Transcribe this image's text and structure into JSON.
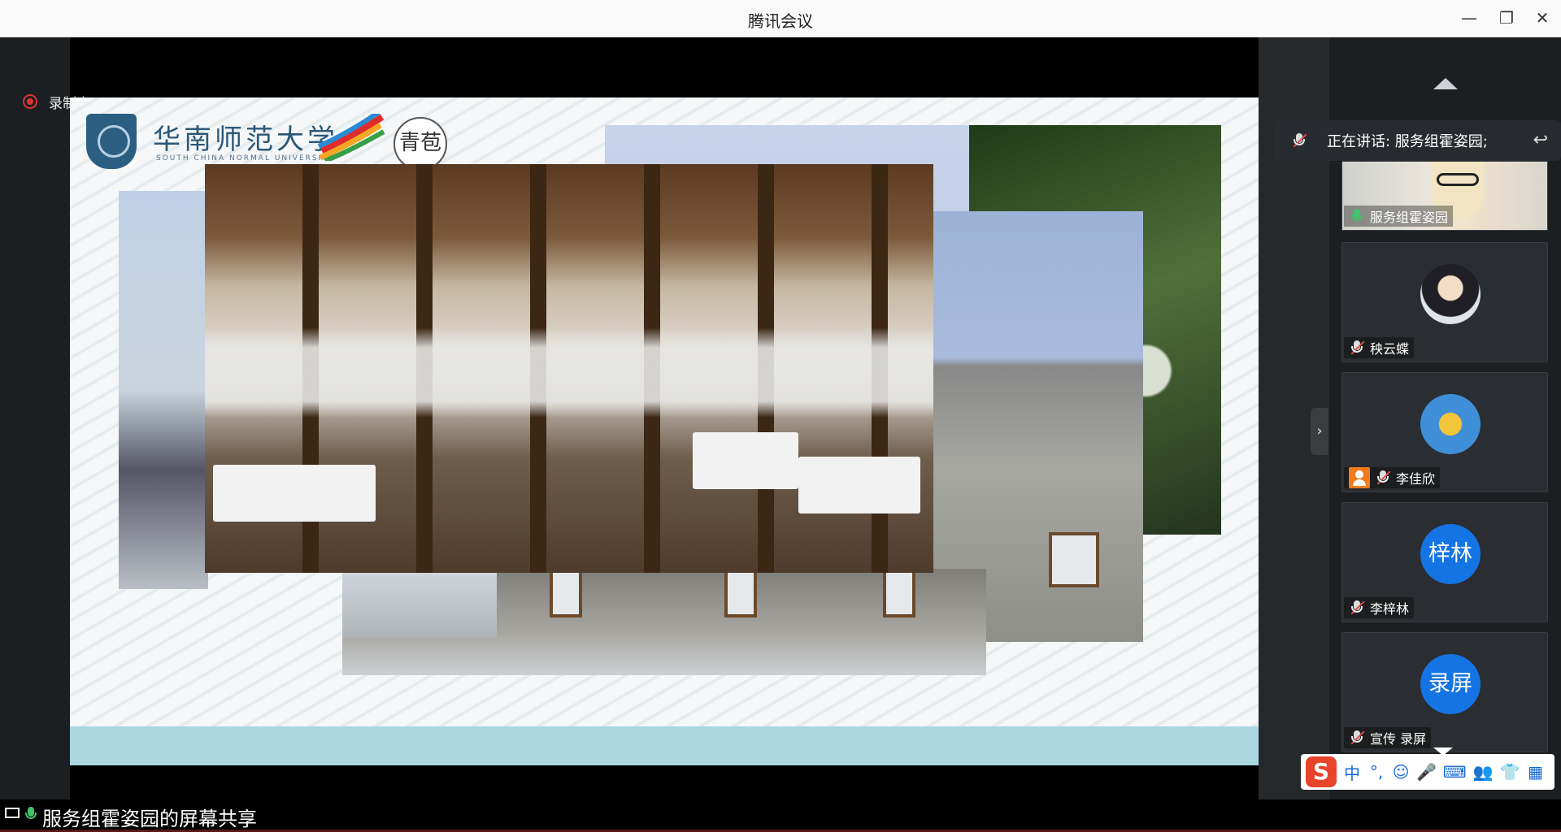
{
  "window": {
    "title": "腾讯会议",
    "controls": [
      "minimize-icon",
      "restore-icon",
      "close-icon"
    ]
  },
  "recording": {
    "label": "录制中"
  },
  "slide": {
    "logo_main": "华南师范大学",
    "logo_sub": "SOUTH CHINA NORMAL UNIVERSITY",
    "logo_seal": "青苞"
  },
  "speaking_banner": {
    "text": "正在讲话: 服务组霍姿园;"
  },
  "participants": [
    {
      "name": "服务组霍姿园",
      "mic": "on",
      "avatar": "photo"
    },
    {
      "name": "秧云蝶",
      "mic": "muted",
      "avatar": "photo"
    },
    {
      "name": "李佳欣",
      "mic": "muted",
      "avatar": "photo",
      "badge": "person-icon"
    },
    {
      "name": "李梓林",
      "mic": "muted",
      "avatar": "text",
      "avatar_text": "梓林",
      "avatar_color": "#1574e4"
    },
    {
      "name": "宣传 录屏",
      "mic": "muted",
      "avatar": "text",
      "avatar_text": "录屏",
      "avatar_color": "#1574e4"
    }
  ],
  "ime": {
    "brand": "S",
    "items": [
      "中",
      "°,",
      "☺",
      "🎤",
      "⌨",
      "👥",
      "👕",
      "▦"
    ]
  },
  "sharebar": {
    "label": "服务组霍姿园的屏幕共享"
  },
  "colors": {
    "accent": "#1574e4",
    "muted": "#e04b4b",
    "speaking": "#43c16a"
  }
}
